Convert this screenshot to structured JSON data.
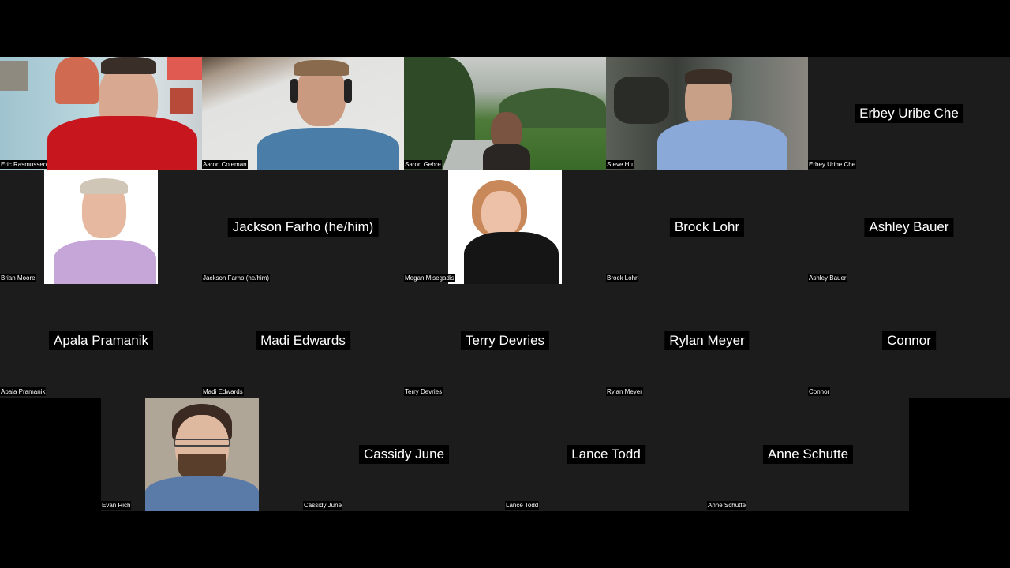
{
  "meeting": {
    "view": "gallery",
    "participants": [
      {
        "name": "Eric Rasmussen",
        "display": "video"
      },
      {
        "name": "Aaron Coleman",
        "display": "video"
      },
      {
        "name": "Saron Gebre",
        "display": "video"
      },
      {
        "name": "Steve Hu",
        "display": "video"
      },
      {
        "name": "Erbey Uribe Che",
        "display": "name"
      },
      {
        "name": "Brian Moore",
        "display": "photo"
      },
      {
        "name": "Jackson Farho (he/him)",
        "display": "name"
      },
      {
        "name": "Megan Misegadis",
        "display": "photo"
      },
      {
        "name": "Brock Lohr",
        "display": "name"
      },
      {
        "name": "Ashley Bauer",
        "display": "name"
      },
      {
        "name": "Apala Pramanik",
        "display": "name"
      },
      {
        "name": "Madi Edwards",
        "display": "name"
      },
      {
        "name": "Terry Devries",
        "display": "name"
      },
      {
        "name": "Rylan Meyer",
        "display": "name"
      },
      {
        "name": "Connor",
        "display": "name"
      },
      {
        "name": "Evan Rich",
        "display": "photo"
      },
      {
        "name": "Cassidy June",
        "display": "name"
      },
      {
        "name": "Lance Todd",
        "display": "name"
      },
      {
        "name": "Anne Schutte",
        "display": "name"
      }
    ]
  }
}
